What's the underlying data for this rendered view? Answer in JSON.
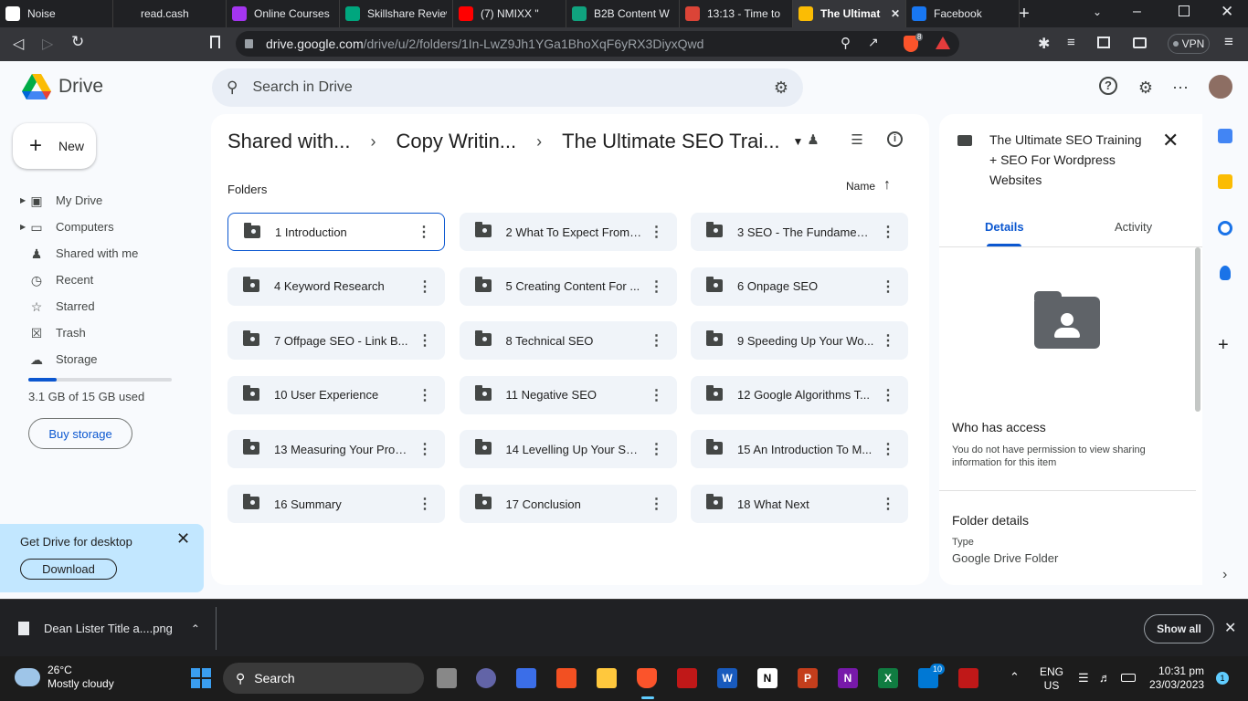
{
  "browser": {
    "tabs": [
      {
        "label": "Noise",
        "icon": "notion-icon",
        "color": "#ffffff"
      },
      {
        "label": "read.cash",
        "icon": "readcash-icon",
        "color": "#202124"
      },
      {
        "label": "Online Courses",
        "icon": "udemy-icon",
        "color": "#a435f0"
      },
      {
        "label": "Skillshare Review",
        "icon": "star-icon",
        "color": "#00a67e"
      },
      {
        "label": "(7) NMIXX \"",
        "icon": "youtube-icon",
        "color": "#ff0000"
      },
      {
        "label": "B2B Content W",
        "icon": "chatgpt-icon",
        "color": "#10a37f"
      },
      {
        "label": "13:13 - Time to",
        "icon": "check-icon",
        "color": "#db4437"
      },
      {
        "label": "The Ultimat",
        "icon": "drive-icon",
        "color": "#fbbc04",
        "active": true
      },
      {
        "label": "Facebook",
        "icon": "facebook-icon",
        "color": "#1877f2"
      }
    ],
    "url_host": "drive.google.com",
    "url_path": "/drive/u/2/folders/1In-LwZ9Jh1YGa1BhoXqF6yRX3DiyxQwd",
    "vpn_label": "VPN",
    "brave_badge": "8"
  },
  "drive": {
    "app_name": "Drive",
    "search_placeholder": "Search in Drive",
    "new_label": "New",
    "nav": [
      {
        "label": "My Drive",
        "icon": "my-drive-icon",
        "expandable": true
      },
      {
        "label": "Computers",
        "icon": "computers-icon",
        "expandable": true
      },
      {
        "label": "Shared with me",
        "icon": "shared-icon",
        "expandable": false
      },
      {
        "label": "Recent",
        "icon": "clock-icon",
        "expandable": false
      },
      {
        "label": "Starred",
        "icon": "star-icon",
        "expandable": false
      },
      {
        "label": "Trash",
        "icon": "trash-icon",
        "expandable": false
      },
      {
        "label": "Storage",
        "icon": "cloud-icon",
        "expandable": false
      }
    ],
    "storage_fraction": 0.2,
    "storage_text": "3.1 GB of 15 GB used",
    "buy_storage": "Buy storage",
    "promo_title": "Get Drive for desktop",
    "promo_button": "Download",
    "breadcrumbs": [
      "Shared with...",
      "Copy Writin...",
      "The Ultimate SEO Trai..."
    ],
    "folders_label": "Folders",
    "sort_label": "Name",
    "folders": [
      "1 Introduction",
      "2 What To Expect From ...",
      "3 SEO - The Fundament...",
      "4 Keyword Research",
      "5 Creating Content For ...",
      "6 Onpage SEO",
      "7 Offpage SEO - Link B...",
      "8 Technical SEO",
      "9 Speeding Up Your Wo...",
      "10 User Experience",
      "11 Negative SEO",
      "12 Google Algorithms T...",
      "13 Measuring Your Prog...",
      "14 Levelling Up Your SE...",
      "15 An Introduction To M...",
      "16 Summary",
      "17 Conclusion",
      "18 What Next"
    ]
  },
  "details": {
    "title": "The Ultimate SEO Training + SEO For Wordpress Websites",
    "tab_details": "Details",
    "tab_activity": "Activity",
    "access_heading": "Who has access",
    "access_text": "You do not have permission to view sharing information for this item",
    "folder_details_heading": "Folder details",
    "type_label": "Type",
    "type_value": "Google Drive Folder"
  },
  "downloads": {
    "file_name": "Dean Lister Title a....png",
    "show_all": "Show all"
  },
  "taskbar": {
    "temperature": "26°C",
    "weather": "Mostly cloudy",
    "search": "Search",
    "lang1": "ENG",
    "lang2": "US",
    "time": "10:31 pm",
    "date": "23/03/2023",
    "notif_badge": "1",
    "onedrive_badge": "10"
  }
}
